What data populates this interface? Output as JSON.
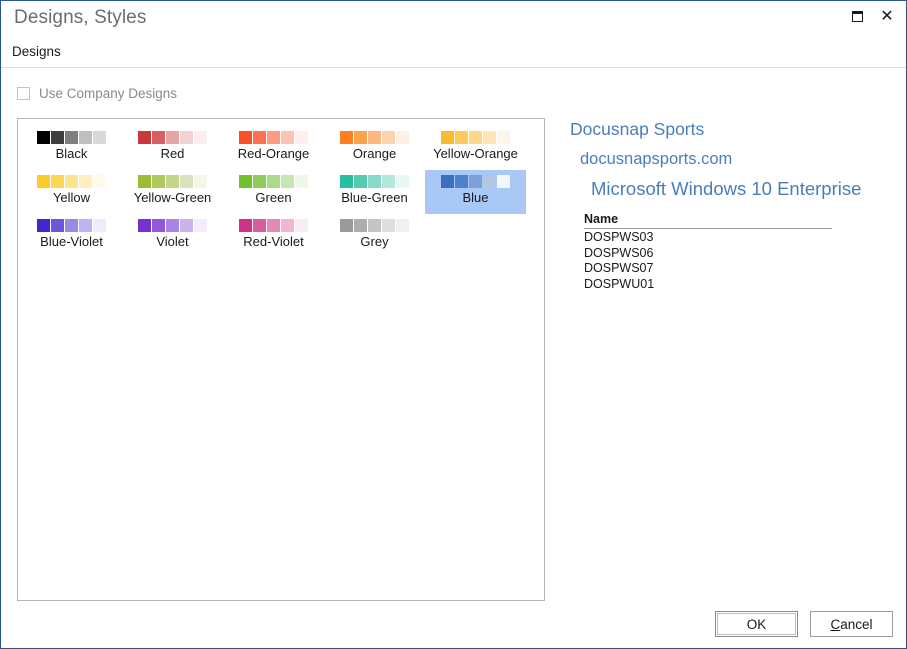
{
  "window": {
    "title": "Designs, Styles",
    "border_color": "#2a5699",
    "buttons": [
      {
        "name": "restore-button",
        "icon": "restore-icon",
        "label": "Restore"
      },
      {
        "name": "close-button",
        "icon": "close-icon",
        "label": "✕"
      }
    ]
  },
  "tabs": [
    {
      "label": "Designs",
      "selected": true
    }
  ],
  "options": {
    "use_company_designs": {
      "label": "Use Company Designs",
      "checked": false,
      "enabled": false
    }
  },
  "designs": {
    "selected": "Blue",
    "items": [
      {
        "label": "Black",
        "colors": [
          "#000000",
          "#3f3f3f",
          "#7f7f7f",
          "#bfbfbf",
          "#d9d9d9"
        ]
      },
      {
        "label": "Red",
        "colors": [
          "#c9393b",
          "#d65f61",
          "#e5a6a7",
          "#f2d3d4",
          "#faeeee"
        ]
      },
      {
        "label": "Red-Orange",
        "colors": [
          "#fb4f25",
          "#fc7154",
          "#fd9a84",
          "#fec2b3",
          "#fdefe9"
        ]
      },
      {
        "label": "Orange",
        "colors": [
          "#fc8021",
          "#fba24d",
          "#fcb97f",
          "#fdd3ad",
          "#fdf0e4"
        ]
      },
      {
        "label": "Yellow-Orange",
        "colors": [
          "#fcbb2e",
          "#fcca58",
          "#fdd888",
          "#fee5b4",
          "#fdf6e8"
        ]
      },
      {
        "label": "Yellow",
        "colors": [
          "#fbcc2b",
          "#fcd654",
          "#fde490",
          "#feeec0",
          "#fefbe8"
        ]
      },
      {
        "label": "Yellow-Green",
        "colors": [
          "#9bbc33",
          "#afc95e",
          "#c4d68e",
          "#d8e4bb",
          "#f3f7e8"
        ]
      },
      {
        "label": "Green",
        "colors": [
          "#72c02f",
          "#8ecd5b",
          "#abda8a",
          "#c7e6b7",
          "#eef8e7"
        ]
      },
      {
        "label": "Blue-Green",
        "colors": [
          "#27bf9d",
          "#56cbb0",
          "#87dac8",
          "#b5e7dc",
          "#e8f8f4"
        ]
      },
      {
        "label": "Blue",
        "colors": [
          "#3b6fc0",
          "#4f80ca",
          "#7fa0d6",
          "#b3c6e3",
          "#f2f6fd"
        ]
      },
      {
        "label": "Blue-Violet",
        "colors": [
          "#4326cf",
          "#6b57da",
          "#978be4",
          "#bcb4ee",
          "#eeecfb"
        ]
      },
      {
        "label": "Violet",
        "colors": [
          "#7731d1",
          "#9358da",
          "#ab85e4",
          "#c7b4ee",
          "#f2ecfb"
        ]
      },
      {
        "label": "Red-Violet",
        "colors": [
          "#cd3386",
          "#d85d9e",
          "#e489b8",
          "#efb7d2",
          "#faecf3"
        ]
      },
      {
        "label": "Grey",
        "colors": [
          "#9a9a9a",
          "#adadad",
          "#c4c4c4",
          "#dedede",
          "#f0f0f0"
        ]
      }
    ]
  },
  "preview": {
    "accent_color": "#4a7ebb",
    "line1": "Docusnap Sports",
    "line2": "docusnapsports.com",
    "line3": "Microsoft Windows 10 Enterprise",
    "table": {
      "header": "Name",
      "rows": [
        "DOSPWS03",
        "DOSPWS06",
        "DOSPWS07",
        "DOSPWU01"
      ]
    }
  },
  "footer": {
    "ok": "OK",
    "cancel_accel": "C",
    "cancel_rest": "ancel"
  }
}
